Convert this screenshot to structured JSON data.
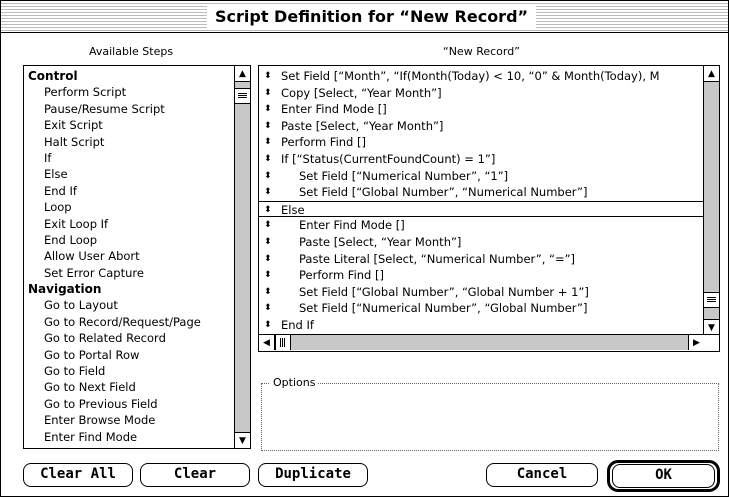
{
  "window": {
    "title": "Script Definition for “New Record”"
  },
  "available_steps": {
    "caption": "Available Steps",
    "items": [
      {
        "label": "Control",
        "category": true
      },
      {
        "label": "Perform Script",
        "category": false
      },
      {
        "label": "Pause/Resume Script",
        "category": false
      },
      {
        "label": "Exit Script",
        "category": false
      },
      {
        "label": "Halt Script",
        "category": false
      },
      {
        "label": "If",
        "category": false
      },
      {
        "label": "Else",
        "category": false
      },
      {
        "label": "End If",
        "category": false
      },
      {
        "label": "Loop",
        "category": false
      },
      {
        "label": "Exit Loop If",
        "category": false
      },
      {
        "label": "End Loop",
        "category": false
      },
      {
        "label": "Allow User Abort",
        "category": false
      },
      {
        "label": "Set Error Capture",
        "category": false
      },
      {
        "label": "Navigation",
        "category": true
      },
      {
        "label": "Go to Layout",
        "category": false
      },
      {
        "label": "Go to Record/Request/Page",
        "category": false
      },
      {
        "label": "Go to Related Record",
        "category": false
      },
      {
        "label": "Go to Portal Row",
        "category": false
      },
      {
        "label": "Go to Field",
        "category": false
      },
      {
        "label": "Go to Next Field",
        "category": false
      },
      {
        "label": "Go to Previous Field",
        "category": false
      },
      {
        "label": "Enter Browse Mode",
        "category": false
      },
      {
        "label": "Enter Find Mode",
        "category": false
      }
    ]
  },
  "script": {
    "caption": "“New Record”",
    "steps": [
      {
        "text": "Set Field [“Month”, “If(Month(Today) < 10, “0” & Month(Today), M",
        "indent": false,
        "selected": false
      },
      {
        "text": "Copy [Select, “Year Month”]",
        "indent": false,
        "selected": false
      },
      {
        "text": "Enter Find Mode []",
        "indent": false,
        "selected": false
      },
      {
        "text": "Paste [Select, “Year Month”]",
        "indent": false,
        "selected": false
      },
      {
        "text": "Perform Find []",
        "indent": false,
        "selected": false
      },
      {
        "text": "If [“Status(CurrentFoundCount) = 1”]",
        "indent": false,
        "selected": false
      },
      {
        "text": "Set Field [“Numerical Number”, “1”]",
        "indent": true,
        "selected": false
      },
      {
        "text": "Set Field [“Global Number”, “Numerical Number”]",
        "indent": true,
        "selected": false
      },
      {
        "text": "Else",
        "indent": false,
        "selected": true
      },
      {
        "text": "Enter Find Mode []",
        "indent": true,
        "selected": false
      },
      {
        "text": "Paste [Select, “Year Month”]",
        "indent": true,
        "selected": false
      },
      {
        "text": "Paste Literal [Select, “Numerical Number”, “=”]",
        "indent": true,
        "selected": false
      },
      {
        "text": "Perform Find []",
        "indent": true,
        "selected": false
      },
      {
        "text": "Set Field [“Global Number”, “Global Number + 1”]",
        "indent": true,
        "selected": false
      },
      {
        "text": "Set Field [“Numerical Number”, “Global Number”]",
        "indent": true,
        "selected": false
      },
      {
        "text": "End If",
        "indent": false,
        "selected": false
      }
    ]
  },
  "options": {
    "label": "Options"
  },
  "buttons": {
    "clear_all": "Clear All",
    "clear": "Clear",
    "duplicate": "Duplicate",
    "cancel": "Cancel",
    "ok": "OK"
  },
  "icons": {
    "scroll_up": "up-arrow-icon",
    "scroll_down": "down-arrow-icon",
    "scroll_left": "left-arrow-icon",
    "scroll_right": "right-arrow-icon",
    "step_handle": "reorder-handle-icon"
  }
}
